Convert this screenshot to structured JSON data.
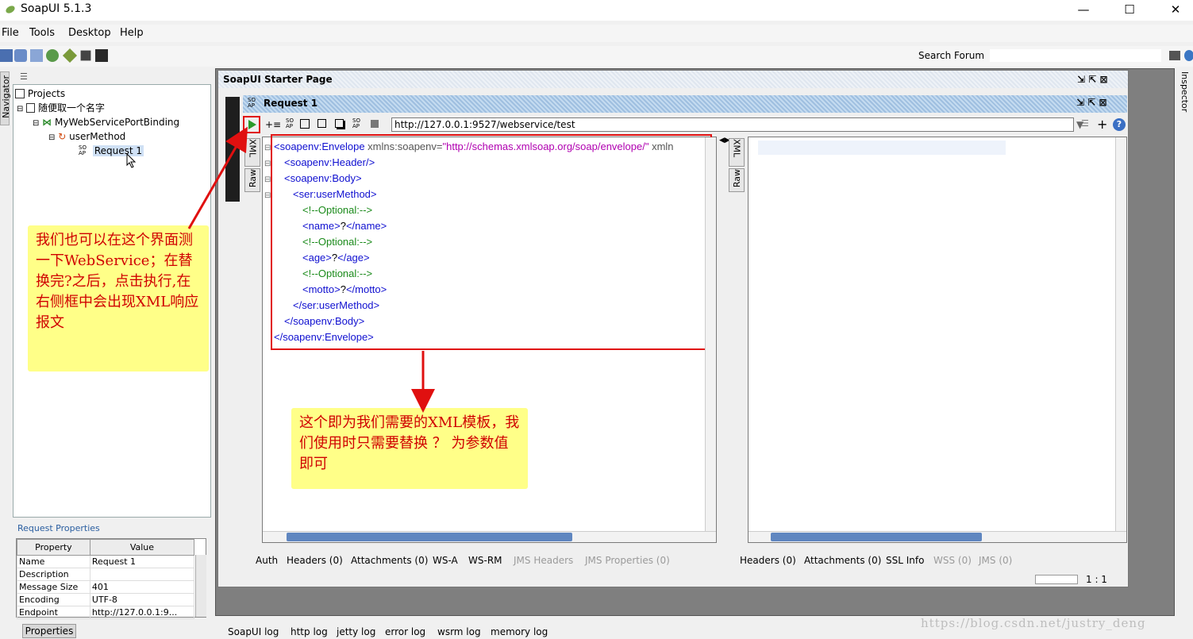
{
  "window": {
    "title": "SoapUI 5.1.3"
  },
  "menu": [
    "File",
    "Tools",
    "Desktop",
    "Help"
  ],
  "toolbar": {
    "search_label": "Search Forum"
  },
  "navigator": {
    "tab_label": "Navigator",
    "tree": [
      "Projects",
      "随便取一个名字",
      "MyWebServicePortBinding",
      "userMethod",
      "Request 1"
    ]
  },
  "properties": {
    "title": "Request Properties",
    "headers": [
      "Property",
      "Value"
    ],
    "rows": [
      [
        "Name",
        "Request 1"
      ],
      [
        "Description",
        ""
      ],
      [
        "Message Size",
        "401"
      ],
      [
        "Encoding",
        "UTF-8"
      ],
      [
        "Endpoint",
        "http://127.0.0.1:9..."
      ]
    ],
    "tab_label": "Properties"
  },
  "starter_page": {
    "title": "SoapUI Starter Page"
  },
  "request": {
    "title": "Request 1",
    "url": "http://127.0.0.1:9527/webservice/test",
    "side_tabs": [
      "XML",
      "Raw"
    ],
    "xml": {
      "l1_tag": "<soapenv:Envelope",
      "l1_attr": " xmlns:soapenv=",
      "l1_str": "\"http://schemas.xmlsoap.org/soap/envelope/\"",
      "l1_rest": " xmln",
      "l2": "<soapenv:Header/>",
      "l3": "<soapenv:Body>",
      "l4": "<ser:userMethod>",
      "l5": "<!--Optional:-->",
      "l6a": "<name>",
      "l6b": "?",
      "l6c": "</name>",
      "l7": "<!--Optional:-->",
      "l8a": "<age>",
      "l8b": "?",
      "l8c": "</age>",
      "l9": "<!--Optional:-->",
      "l10a": "<motto>",
      "l10b": "?",
      "l10c": "</motto>",
      "l11": "</ser:userMethod>",
      "l12": "</soapenv:Body>",
      "l13": "</soapenv:Envelope>"
    },
    "bottom_tabs": [
      "Auth",
      "Headers (0)",
      "Attachments (0)",
      "WS-A",
      "WS-RM",
      "JMS Headers",
      "JMS Properties (0)"
    ]
  },
  "response": {
    "side_tabs": [
      "XML",
      "Raw"
    ],
    "bottom_tabs": [
      "Headers (0)",
      "Attachments (0)",
      "SSL Info",
      "WSS (0)",
      "JMS (0)"
    ]
  },
  "status": {
    "position": "1 : 1"
  },
  "inspector": {
    "tab_label": "Inspector"
  },
  "logs": [
    "SoapUI log",
    "http log",
    "jetty log",
    "error log",
    "wsrm log",
    "memory log"
  ],
  "annotations": {
    "left_note": "我们也可以在这个界面测一下WebService；在替换完?之后，点击执行,在右侧框中会出现XML响应报文",
    "center_note": "这个即为我们需要的XML模板，我们使用时只需要替换 ？ 为参数值即可"
  },
  "watermark": "https://blog.csdn.net/justry_deng",
  "colors": {
    "note_bg": "#ffff88",
    "note_text": "#d00000",
    "highlight_box": "#e01010",
    "xml_tag": "#1010d0",
    "xml_string": "#b000b0",
    "xml_comment": "#1a8a1a"
  }
}
